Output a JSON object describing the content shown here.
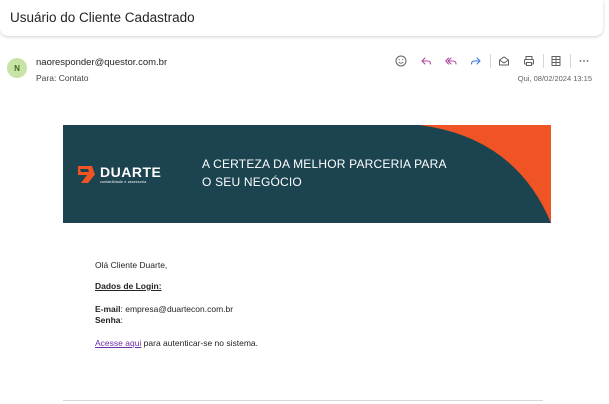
{
  "message": {
    "subject": "Usuário do Cliente Cadastrado",
    "avatar_initial": "N",
    "sender": "naoresponder@questor.com.br",
    "to_label": "Para:",
    "to_value": "Contato",
    "date": "Qui, 08/02/2024 13:15"
  },
  "toolbar": {
    "icons": [
      "emoji-icon",
      "reply-icon",
      "reply-all-icon",
      "forward-icon",
      "mark-unread-icon",
      "print-icon",
      "apps-icon",
      "more-options-icon"
    ]
  },
  "banner": {
    "brand": "DUARTE",
    "tagline": "contabilidade e assessoria",
    "headline_line1": "A CERTEZA DA MELHOR PARCERIA PARA",
    "headline_line2": "O SEU NEGÓCIO",
    "colors": {
      "background": "#1c4450",
      "accent": "#f05424"
    }
  },
  "content": {
    "greeting": "Olá Cliente Duarte,",
    "login_title": "Dados de Login:",
    "email_label": "E-mail",
    "email_value": ": empresa@duartecon.com.br",
    "password_label": "Senha",
    "password_value": ":",
    "access_link": "Acesse aqui",
    "access_text": " para autenticar-se no sistema."
  }
}
